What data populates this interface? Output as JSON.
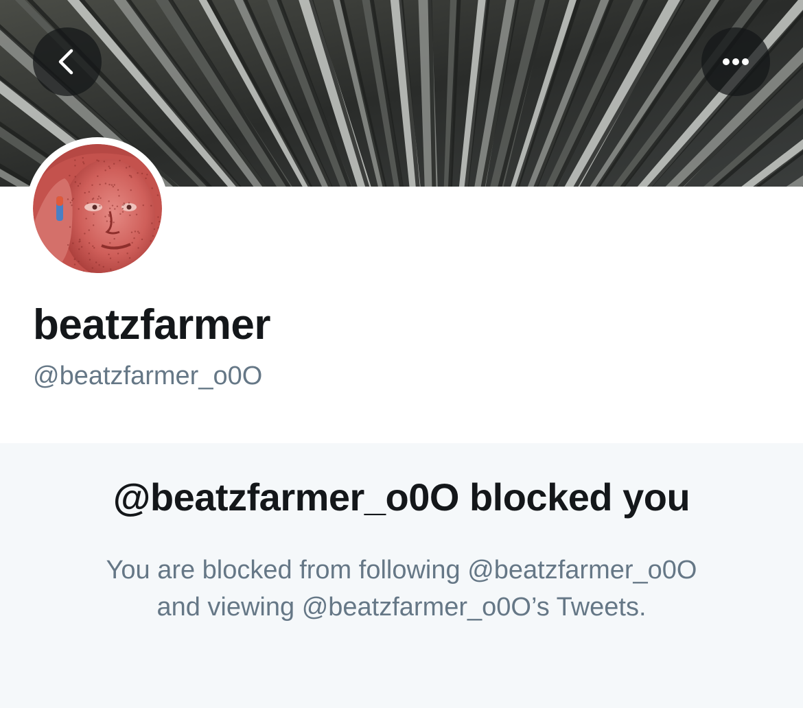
{
  "header": {
    "back_icon": "chevron-left-icon",
    "more_icon": "ellipsis-icon"
  },
  "profile": {
    "display_name": "beatzfarmer",
    "handle": "@beatzfarmer_o0O"
  },
  "blocked": {
    "title": "@beatzfarmer_o0O blocked you",
    "line1": "You are blocked from following @beatzfarmer_o0O",
    "line2": "and viewing @beatzfarmer_o0O’s Tweets."
  },
  "colors": {
    "text_primary": "#14171a",
    "text_secondary": "#657786",
    "panel_background": "#f5f8fa"
  }
}
